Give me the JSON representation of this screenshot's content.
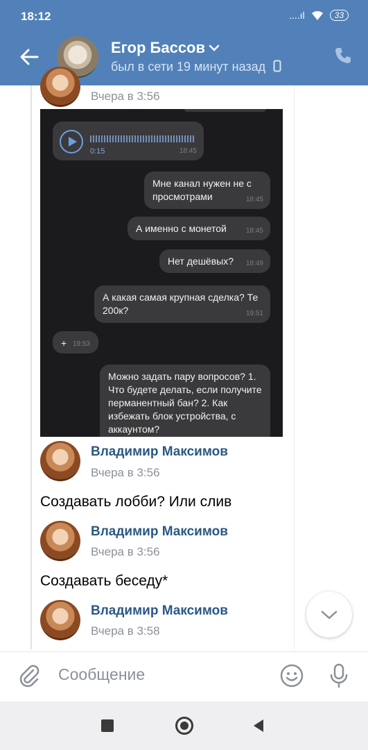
{
  "status_bar": {
    "time": "18:12",
    "signal": "....ıl",
    "battery": "33"
  },
  "header": {
    "contact_name": "Егор Бассов",
    "contact_status": "был в сети 19 минут назад"
  },
  "messages": [
    {
      "author": "",
      "time": "Вчера в 3:56",
      "text": ""
    },
    {
      "author": "Владимир Максимов",
      "time": "Вчера в 3:56",
      "text": "Создавать лобби? Или слив"
    },
    {
      "author": "Владимир Максимов",
      "time": "Вчера в 3:56",
      "text": "Создавать беседу*"
    },
    {
      "author": "Владимир Максимов",
      "time": "Вчера в 3:58",
      "text": ""
    }
  ],
  "screenshot": {
    "voice": {
      "duration": "0:15",
      "time": "18:45"
    },
    "bubbles": [
      {
        "text": "Мне канал нужен не с просмотрами",
        "time": "18:45"
      },
      {
        "text": "А именно с монетой",
        "time": "18:45"
      },
      {
        "text": "Нет дешёвых?",
        "time": "18:49"
      },
      {
        "text": "А какая самая крупная сделка? Те 200к?",
        "time": "19:51"
      },
      {
        "text": "+",
        "time": "19:53"
      },
      {
        "text": "Можно задать пару вопросов? 1. Что будете делать, если получите перманентный бан? 2. Как избежать блок устройства, с аккаунтом?",
        "time": ""
      }
    ]
  },
  "input": {
    "placeholder": "Сообщение"
  },
  "colors": {
    "header": "#5181b8",
    "link": "#2a5885",
    "time": "#8a9099"
  }
}
